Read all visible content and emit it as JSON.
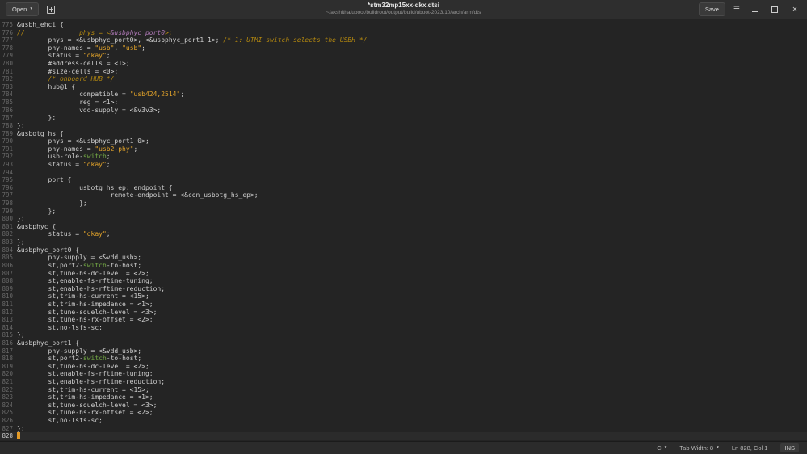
{
  "header": {
    "open_button": "Open",
    "title": "*stm32mp15xx-dkx.dtsi",
    "subtitle": "~/akshitha/uboot/buildroot/output/build/uboot-2023.10/arch/arm/dts",
    "save_button": "Save"
  },
  "icons": {
    "caret": "▾",
    "menu": "☰",
    "close": "✕"
  },
  "statusbar": {
    "language": "C",
    "tab_width": "Tab Width: 8",
    "cursor_position": "Ln 828, Col 1",
    "mode": "INS"
  },
  "colors": {
    "background": "#242424",
    "header_background": "#2e2e2e",
    "text": "#cfcfcf",
    "line_number": "#686868",
    "string": "#e2a32a",
    "comment": "#b5890f",
    "keyword": "#74a944",
    "reference": "#b07ab8",
    "cursor": "#e39a27"
  },
  "editor": {
    "lines": [
      {
        "n": 775,
        "s": [
          [
            "pl",
            "&usbh_ehci {"
          ]
        ]
      },
      {
        "n": 776,
        "s": [
          [
            "com",
            "//              phys = <"
          ],
          [
            "pur",
            "&usbphyc_port0"
          ],
          [
            "com",
            ">;"
          ]
        ]
      },
      {
        "n": 777,
        "s": [
          [
            "pl",
            "        phys = <&usbphyc_port0>, <&usbphyc_port1 1>; "
          ],
          [
            "com",
            "/* 1: UTMI switch selects the USBH */"
          ]
        ]
      },
      {
        "n": 778,
        "s": [
          [
            "pl",
            "        phy-names = "
          ],
          [
            "str",
            "\"usb\""
          ],
          [
            "pl",
            ", "
          ],
          [
            "str",
            "\"usb\""
          ],
          [
            "pl",
            ";"
          ]
        ]
      },
      {
        "n": 779,
        "s": [
          [
            "pl",
            "        status = "
          ],
          [
            "str",
            "\"okay\""
          ],
          [
            "pl",
            ";"
          ]
        ]
      },
      {
        "n": 780,
        "s": [
          [
            "pl",
            "        #address-cells = <1>;"
          ]
        ]
      },
      {
        "n": 781,
        "s": [
          [
            "pl",
            "        #size-cells = <0>;"
          ]
        ]
      },
      {
        "n": 782,
        "s": [
          [
            "pl",
            "        "
          ],
          [
            "com",
            "/* onboard HUB */"
          ]
        ]
      },
      {
        "n": 783,
        "s": [
          [
            "pl",
            "        hub@1 {"
          ]
        ]
      },
      {
        "n": 784,
        "s": [
          [
            "pl",
            "                compatible = "
          ],
          [
            "str",
            "\"usb424,2514\""
          ],
          [
            "pl",
            ";"
          ]
        ]
      },
      {
        "n": 785,
        "s": [
          [
            "pl",
            "                reg = <1>;"
          ]
        ]
      },
      {
        "n": 786,
        "s": [
          [
            "pl",
            "                vdd-supply = <&v3v3>;"
          ]
        ]
      },
      {
        "n": 787,
        "s": [
          [
            "pl",
            "        };"
          ]
        ]
      },
      {
        "n": 788,
        "s": [
          [
            "pl",
            "};"
          ]
        ]
      },
      {
        "n": 789,
        "s": [
          [
            "pl",
            "&usbotg_hs {"
          ]
        ]
      },
      {
        "n": 790,
        "s": [
          [
            "pl",
            "        phys = <&usbphyc_port1 0>;"
          ]
        ]
      },
      {
        "n": 791,
        "s": [
          [
            "pl",
            "        phy-names = "
          ],
          [
            "str",
            "\"usb2-phy\""
          ],
          [
            "pl",
            ";"
          ]
        ]
      },
      {
        "n": 792,
        "s": [
          [
            "pl",
            "        usb-role-"
          ],
          [
            "kw",
            "switch"
          ],
          [
            "pl",
            ";"
          ]
        ]
      },
      {
        "n": 793,
        "s": [
          [
            "pl",
            "        status = "
          ],
          [
            "str",
            "\"okay\""
          ],
          [
            "pl",
            ";"
          ]
        ]
      },
      {
        "n": 794,
        "s": []
      },
      {
        "n": 795,
        "s": [
          [
            "pl",
            "        port {"
          ]
        ]
      },
      {
        "n": 796,
        "s": [
          [
            "pl",
            "                usbotg_hs_ep: endpoint {"
          ]
        ]
      },
      {
        "n": 797,
        "s": [
          [
            "pl",
            "                        remote-endpoint = <&con_usbotg_hs_ep>;"
          ]
        ]
      },
      {
        "n": 798,
        "s": [
          [
            "pl",
            "                };"
          ]
        ]
      },
      {
        "n": 799,
        "s": [
          [
            "pl",
            "        };"
          ]
        ]
      },
      {
        "n": 800,
        "s": [
          [
            "pl",
            "};"
          ]
        ]
      },
      {
        "n": 801,
        "s": [
          [
            "pl",
            "&usbphyc {"
          ]
        ]
      },
      {
        "n": 802,
        "s": [
          [
            "pl",
            "        status = "
          ],
          [
            "str",
            "\"okay\""
          ],
          [
            "pl",
            ";"
          ]
        ]
      },
      {
        "n": 803,
        "s": [
          [
            "pl",
            "};"
          ]
        ]
      },
      {
        "n": 804,
        "s": [
          [
            "pl",
            "&usbphyc_port0 {"
          ]
        ]
      },
      {
        "n": 805,
        "s": [
          [
            "pl",
            "        phy-supply = <&vdd_usb>;"
          ]
        ]
      },
      {
        "n": 806,
        "s": [
          [
            "pl",
            "        st,port2-"
          ],
          [
            "kw",
            "switch"
          ],
          [
            "pl",
            "-to-host;"
          ]
        ]
      },
      {
        "n": 807,
        "s": [
          [
            "pl",
            "        st,tune-hs-dc-level = <2>;"
          ]
        ]
      },
      {
        "n": 808,
        "s": [
          [
            "pl",
            "        st,enable-fs-rftime-tuning;"
          ]
        ]
      },
      {
        "n": 809,
        "s": [
          [
            "pl",
            "        st,enable-hs-rftime-reduction;"
          ]
        ]
      },
      {
        "n": 810,
        "s": [
          [
            "pl",
            "        st,trim-hs-current = <15>;"
          ]
        ]
      },
      {
        "n": 811,
        "s": [
          [
            "pl",
            "        st,trim-hs-impedance = <1>;"
          ]
        ]
      },
      {
        "n": 812,
        "s": [
          [
            "pl",
            "        st,tune-squelch-level = <3>;"
          ]
        ]
      },
      {
        "n": 813,
        "s": [
          [
            "pl",
            "        st,tune-hs-rx-offset = <2>;"
          ]
        ]
      },
      {
        "n": 814,
        "s": [
          [
            "pl",
            "        st,no-lsfs-sc;"
          ]
        ]
      },
      {
        "n": 815,
        "s": [
          [
            "pl",
            "};"
          ]
        ]
      },
      {
        "n": 816,
        "s": [
          [
            "pl",
            "&usbphyc_port1 {"
          ]
        ]
      },
      {
        "n": 817,
        "s": [
          [
            "pl",
            "        phy-supply = <&vdd_usb>;"
          ]
        ]
      },
      {
        "n": 818,
        "s": [
          [
            "pl",
            "        st,port2-"
          ],
          [
            "kw",
            "switch"
          ],
          [
            "pl",
            "-to-host;"
          ]
        ]
      },
      {
        "n": 819,
        "s": [
          [
            "pl",
            "        st,tune-hs-dc-level = <2>;"
          ]
        ]
      },
      {
        "n": 820,
        "s": [
          [
            "pl",
            "        st,enable-fs-rftime-tuning;"
          ]
        ]
      },
      {
        "n": 821,
        "s": [
          [
            "pl",
            "        st,enable-hs-rftime-reduction;"
          ]
        ]
      },
      {
        "n": 822,
        "s": [
          [
            "pl",
            "        st,trim-hs-current = <15>;"
          ]
        ]
      },
      {
        "n": 823,
        "s": [
          [
            "pl",
            "        st,trim-hs-impedance = <1>;"
          ]
        ]
      },
      {
        "n": 824,
        "s": [
          [
            "pl",
            "        st,tune-squelch-level = <3>;"
          ]
        ]
      },
      {
        "n": 825,
        "s": [
          [
            "pl",
            "        st,tune-hs-rx-offset = <2>;"
          ]
        ]
      },
      {
        "n": 826,
        "s": [
          [
            "pl",
            "        st,no-lsfs-sc;"
          ]
        ]
      },
      {
        "n": 827,
        "s": [
          [
            "pl",
            "};"
          ]
        ]
      },
      {
        "n": 828,
        "s": [],
        "cursor": true
      }
    ]
  }
}
